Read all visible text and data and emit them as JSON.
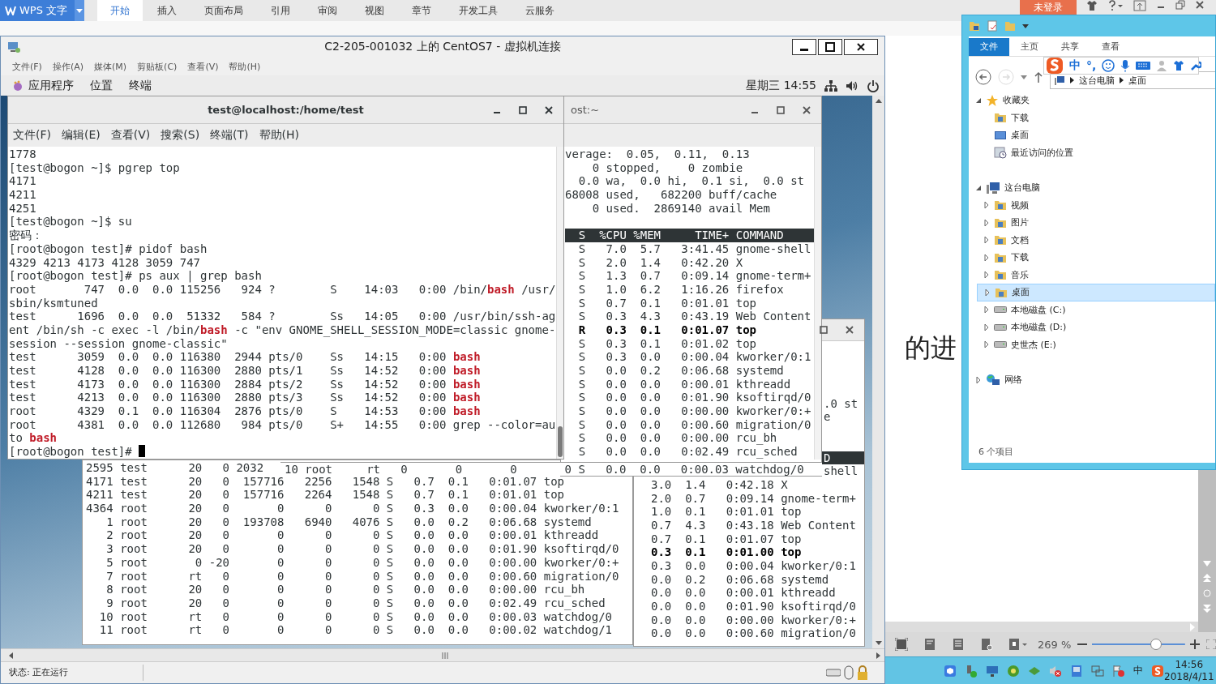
{
  "wps": {
    "app_button": "WPS 文字",
    "tabs": [
      {
        "label": "开始",
        "selected": true
      },
      {
        "label": "插入",
        "selected": false
      },
      {
        "label": "页面布局",
        "selected": false
      },
      {
        "label": "引用",
        "selected": false
      },
      {
        "label": "审阅",
        "selected": false
      },
      {
        "label": "视图",
        "selected": false
      },
      {
        "label": "章节",
        "selected": false
      },
      {
        "label": "开发工具",
        "selected": false
      },
      {
        "label": "云服务",
        "selected": false
      }
    ],
    "login": "未登录"
  },
  "document": {
    "text": "的进"
  },
  "vm_window": {
    "title": "C2-205-001032 上的 CentOS7 - 虚拟机连接",
    "menu": [
      "文件(F)",
      "操作(A)",
      "媒体(M)",
      "剪贴板(C)",
      "查看(V)",
      "帮助(H)"
    ],
    "gnome_menus": [
      "应用程序",
      "位置",
      "终端"
    ],
    "clock": "星期三 14:55",
    "status": "状态: 正在运行"
  },
  "terminal_front": {
    "title": "test@localhost:/home/test",
    "menu": [
      "文件(F)",
      "编辑(E)",
      "查看(V)",
      "搜索(S)",
      "终端(T)",
      "帮助(H)"
    ],
    "lines": [
      "1778",
      "[test@bogon ~]$ pgrep top",
      "4171",
      "4211",
      "4251",
      "[test@bogon ~]$ su",
      "密码：",
      "[root@bogon test]# pidof bash",
      "4329 4213 4173 4128 3059 747",
      "[root@bogon test]# ps aux | grep bash",
      "root       747  0.0  0.0 115256   924 ?        S    14:03   0:00 /bin/**bash** /usr/",
      "sbin/ksmtuned",
      "test      1696  0.0  0.0  51332   584 ?        Ss   14:05   0:00 /usr/bin/ssh-ag",
      "ent /bin/sh -c exec -l /bin/**bash** -c \"env GNOME_SHELL_SESSION_MODE=classic gnome-",
      "session --session gnome-classic\"",
      "test      3059  0.0  0.0 116380  2944 pts/0    Ss   14:15   0:00 **bash**",
      "test      4128  0.0  0.0 116300  2880 pts/1    Ss   14:52   0:00 **bash**",
      "test      4173  0.0  0.0 116300  2884 pts/2    Ss   14:52   0:00 **bash**",
      "test      4213  0.0  0.0 116300  2880 pts/3    Ss   14:52   0:00 **bash**",
      "root      4329  0.1  0.0 116304  2876 pts/0    S    14:53   0:00 **bash**",
      "root      4381  0.0  0.0 112680   984 pts/0    S+   14:55   0:00 grep --color=au",
      "to **bash**",
      "[root@bogon test]# "
    ],
    "cursor": true
  },
  "terminal_top": {
    "title": "ost:~",
    "lines": [
      {
        "kind": "text",
        "text": "verage:  0.05,  0.11,  0.13"
      },
      {
        "kind": "text",
        "text": "    0 stopped,    0 zombie"
      },
      {
        "kind": "text",
        "text": "  0.0 wa,  0.0 hi,  0.1 si,  0.0 st"
      },
      {
        "kind": "text",
        "text": "68008 used,   682200 buff/cache"
      },
      {
        "kind": "text",
        "text": "    0 used.  2869140 avail Mem"
      },
      {
        "kind": "blank"
      },
      {
        "kind": "header",
        "text": "  S  %CPU %MEM     TIME+ COMMAND"
      },
      {
        "kind": "text",
        "text": "  S   7.0  5.7   3:41.45 gnome-shell"
      },
      {
        "kind": "text",
        "text": "  S   2.0  1.4   0:42.20 X"
      },
      {
        "kind": "text",
        "text": "  S   1.3  0.7   0:09.14 gnome-term+"
      },
      {
        "kind": "text",
        "text": "  S   1.0  6.2   1:16.26 firefox"
      },
      {
        "kind": "text",
        "text": "  S   0.7  0.1   0:01.01 top"
      },
      {
        "kind": "text",
        "text": "  S   0.3  4.3   0:43.19 Web Content"
      },
      {
        "kind": "bold",
        "text": "  R   0.3  0.1   0:01.07 top"
      },
      {
        "kind": "text",
        "text": "  S   0.3  0.1   0:01.02 top"
      },
      {
        "kind": "text",
        "text": "  S   0.3  0.0   0:00.04 kworker/0:1"
      },
      {
        "kind": "text",
        "text": "  S   0.0  0.2   0:06.68 systemd"
      },
      {
        "kind": "text",
        "text": "  S   0.0  0.0   0:00.01 kthreadd"
      },
      {
        "kind": "text",
        "text": "  S   0.0  0.0   0:01.90 ksoftirqd/0"
      },
      {
        "kind": "text",
        "text": "  S   0.0  0.0   0:00.00 kworker/0:+"
      },
      {
        "kind": "text",
        "text": "  S   0.0  0.0   0:00.60 migration/0"
      },
      {
        "kind": "text",
        "text": "  S   0.0  0.0   0:00.00 rcu_bh"
      },
      {
        "kind": "text",
        "text": "  S   0.0  0.0   0:02.49 rcu_sched"
      }
    ],
    "last_line": "10 root     rt   0       0       0       0 S   0.0  0.0   0:00.03 watchdog/0"
  },
  "terminal_bottom": {
    "lines": [
      "2595 test      20   0 2032",
      "4171 test      20   0  157716   2256   1548 S   0.7  0.1   0:01.07 top",
      "4211 test      20   0  157716   2264   1548 S   0.7  0.1   0:01.01 top",
      "4364 root      20   0       0      0      0 S   0.3  0.0   0:00.04 kworker/0:1",
      "   1 root      20   0  193708   6940   4076 S   0.0  0.2   0:06.68 systemd",
      "   2 root      20   0       0      0      0 S   0.0  0.0   0:00.01 kthreadd",
      "   3 root      20   0       0      0      0 S   0.0  0.0   0:01.90 ksoftirqd/0",
      "   5 root       0 -20       0      0      0 S   0.0  0.0   0:00.00 kworker/0:+",
      "   7 root      rt   0       0      0      0 S   0.0  0.0   0:00.60 migration/0",
      "   8 root      20   0       0      0      0 S   0.0  0.0   0:00.00 rcu_bh",
      "   9 root      20   0       0      0      0 S   0.0  0.0   0:02.49 rcu_sched",
      "  10 root      rt   0       0      0      0 S   0.0  0.0   0:00.03 watchdog/0",
      "  11 root      rt   0       0      0      0 S   0.0  0.0   0:00.02 watchdog/1"
    ]
  },
  "terminal_right": {
    "lines": [
      {
        "kind": "blank"
      },
      {
        "kind": "blank"
      },
      {
        "kind": "blank"
      },
      {
        "kind": "blank"
      },
      {
        "kind": "tail",
        "text": ".0 st"
      },
      {
        "kind": "tail",
        "text": "e"
      },
      {
        "kind": "blank"
      },
      {
        "kind": "blank"
      },
      {
        "kind": "tail_header",
        "text": "D"
      },
      {
        "kind": "tail",
        "text": "shell"
      },
      {
        "kind": "row",
        "text": "3.0  1.4   0:42.18 X"
      },
      {
        "kind": "row",
        "text": "2.0  0.7   0:09.14 gnome-term+"
      },
      {
        "kind": "row",
        "text": "1.0  0.1   0:01.01 top"
      },
      {
        "kind": "row",
        "text": "0.7  4.3   0:43.18 Web Content"
      },
      {
        "kind": "row",
        "text": "0.7  0.1   0:01.07 top"
      },
      {
        "kind": "bold",
        "text": "0.3  0.1   0:01.00 top"
      },
      {
        "kind": "row",
        "text": "0.3  0.0   0:00.04 kworker/0:1"
      },
      {
        "kind": "row",
        "text": "0.0  0.2   0:06.68 systemd"
      },
      {
        "kind": "row",
        "text": "0.0  0.0   0:00.01 kthreadd"
      },
      {
        "kind": "row",
        "text": "0.0  0.0   0:01.90 ksoftirqd/0"
      },
      {
        "kind": "row",
        "text": "0.0  0.0   0:00.00 kworker/0:+"
      },
      {
        "kind": "row",
        "text": "0.0  0.0   0:00.60 migration/0"
      }
    ]
  },
  "explorer": {
    "tabs": [
      {
        "label": "文件",
        "selected": true
      },
      {
        "label": "主页",
        "selected": false
      },
      {
        "label": "共享",
        "selected": false
      },
      {
        "label": "查看",
        "selected": false
      }
    ],
    "address": [
      "这台电脑",
      "桌面"
    ],
    "tree": [
      {
        "label": "收藏夹",
        "kind": "star",
        "expanded": true,
        "selected": false,
        "children": [
          {
            "label": "下载",
            "kind": "folder",
            "selected": false
          },
          {
            "label": "桌面",
            "kind": "desktop",
            "selected": false
          },
          {
            "label": "最近访问的位置",
            "kind": "recent",
            "selected": false
          }
        ]
      },
      {
        "label": "这台电脑",
        "kind": "pc",
        "expanded": true,
        "selected": false,
        "children": [
          {
            "label": "视频",
            "kind": "folder",
            "expanded": false,
            "selected": false
          },
          {
            "label": "图片",
            "kind": "folder",
            "expanded": false,
            "selected": false
          },
          {
            "label": "文档",
            "kind": "folder",
            "expanded": false,
            "selected": false
          },
          {
            "label": "下载",
            "kind": "folder",
            "expanded": false,
            "selected": false
          },
          {
            "label": "音乐",
            "kind": "folder",
            "expanded": false,
            "selected": false
          },
          {
            "label": "桌面",
            "kind": "folder",
            "expanded": false,
            "selected": true
          },
          {
            "label": "本地磁盘 (C:)",
            "kind": "drive",
            "expanded": false,
            "selected": false
          },
          {
            "label": "本地磁盘 (D:)",
            "kind": "drive",
            "expanded": false,
            "selected": false
          },
          {
            "label": "史世杰 (E:)",
            "kind": "drive",
            "expanded": false,
            "selected": false
          }
        ]
      },
      {
        "label": "网络",
        "kind": "network",
        "expanded": false,
        "selected": false
      }
    ],
    "status": "6 个项目"
  },
  "ime": {
    "items": [
      "中",
      "°,"
    ]
  },
  "wps_status": {
    "zoom": "269 %",
    "level": 0.69
  },
  "taskbar": {
    "ime": "中",
    "time": "14:56",
    "date": "2018/4/11"
  }
}
